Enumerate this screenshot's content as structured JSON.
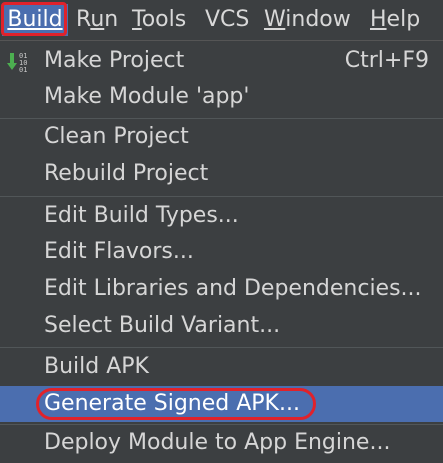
{
  "menubar": {
    "items": [
      {
        "label": "Build",
        "mnemonic_index": 0
      },
      {
        "label": "Run",
        "mnemonic_index": 1
      },
      {
        "label": "Tools",
        "mnemonic_index": 0
      },
      {
        "label": "VCS",
        "mnemonic_index": -1
      },
      {
        "label": "Window",
        "mnemonic_index": 0
      },
      {
        "label": "Help",
        "mnemonic_index": 0
      }
    ]
  },
  "build_menu": {
    "items": [
      {
        "label": "Make Project",
        "shortcut": "Ctrl+F9",
        "icon": "make-project-icon"
      },
      {
        "label": "Make Module 'app'"
      },
      {
        "label": "Clean Project"
      },
      {
        "label": "Rebuild Project"
      },
      {
        "label": "Edit Build Types..."
      },
      {
        "label": "Edit Flavors..."
      },
      {
        "label": "Edit Libraries and Dependencies..."
      },
      {
        "label": "Select Build Variant..."
      },
      {
        "label": "Build APK"
      },
      {
        "label": "Generate Signed APK...",
        "selected": true
      },
      {
        "label": "Deploy Module to App Engine..."
      }
    ]
  },
  "colors": {
    "menu_bg": "#3c3f41",
    "selection_bg": "#4b6eaf",
    "highlight_ring": "#e0222b",
    "icon_arrow": "#4caf50"
  }
}
